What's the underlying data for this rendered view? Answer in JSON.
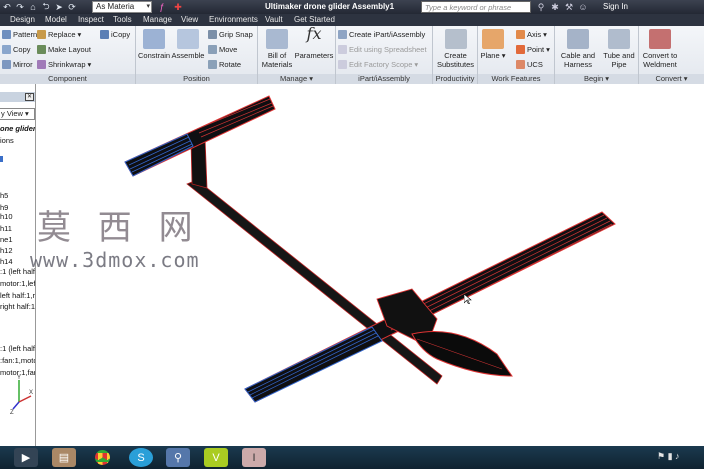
{
  "titlebar": {
    "material": "As Materia",
    "title": "Ultimaker drone glider Assembly1",
    "search_placeholder": "Type a keyword or phrase",
    "signin": "Sign In"
  },
  "menu": [
    "Design",
    "Model",
    "Inspect",
    "Tools",
    "Manage",
    "View",
    "Environments",
    "Vault",
    "Get Started"
  ],
  "ribbon": {
    "component": {
      "label": "Component",
      "pattern": "Pattern",
      "copy": "Copy",
      "mirror": "Mirror",
      "replace": "Replace",
      "make_layout": "Make Layout",
      "shrinkwrap": "Shrinkwrap",
      "icopy": "iCopy"
    },
    "position": {
      "label": "Position",
      "constrain": "Constrain",
      "assemble": "Assemble",
      "grip_snap": "Grip Snap",
      "move": "Move",
      "rotate": "Rotate"
    },
    "manage": {
      "label": "Manage",
      "bom": "Bill of Materials",
      "parameters": "Parameters"
    },
    "ipart": {
      "label": "iPart/iAssembly",
      "create": "Create iPart/iAssembly",
      "edit_spreadsheet": "Edit using Spreadsheet",
      "edit_factory": "Edit Factory Scope"
    },
    "productivity": {
      "label": "Productivity",
      "create_substitutes": "Create Substitutes"
    },
    "work_features": {
      "label": "Work Features",
      "plane": "Plane",
      "axis": "Axis",
      "point": "Point",
      "ucs": "UCS"
    },
    "begin": {
      "label": "Begin",
      "cable": "Cable and Harness",
      "tube": "Tube and Pipe"
    },
    "convert": {
      "label": "Convert",
      "weldment": "Convert to Weldment"
    }
  },
  "browser": {
    "view": "y View",
    "title": "one glider A",
    "items": [
      "ions",
      "h5",
      "h9",
      "h10",
      "h11",
      "ne1",
      "h12",
      "h14",
      ":1 (left half:",
      "motor:1,lef",
      "left half:1,r",
      "right half:1,",
      "",
      ":1 (left half",
      ":fan:1,motor",
      "motor:1,far"
    ]
  },
  "watermark": {
    "cn": "莫 西 网",
    "url": "www.3dmox.com"
  },
  "taskbar": {
    "apps": [
      "media-player",
      "file-explorer",
      "chrome",
      "skype",
      "search",
      "vault",
      "inventor"
    ]
  }
}
